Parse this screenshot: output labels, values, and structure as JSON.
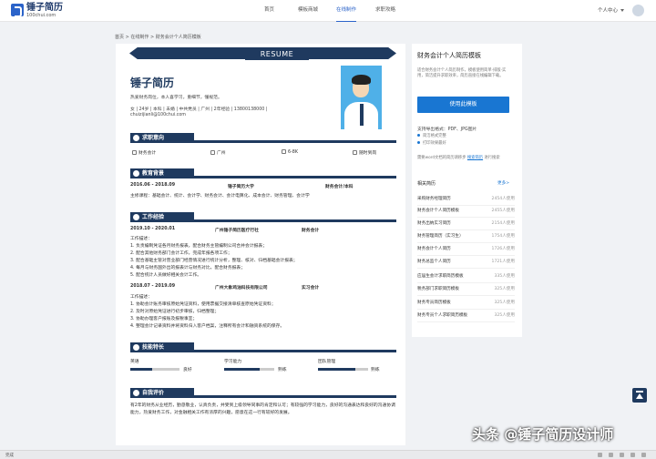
{
  "header": {
    "logo_text": "锤子简历",
    "logo_url": "100chui.com",
    "nav": [
      "首页",
      "模板商城",
      "在线制作",
      "求职攻略"
    ],
    "user_menu": "个人中心"
  },
  "breadcrumb": "首页 > 在线制作 > 财务会计个人简历模板",
  "resume": {
    "banner": "RESUME",
    "name": "锤子简历",
    "tagline": "热爱财务岗位，本人喜学习，重细节，懂规范。",
    "info": "女 | 24岁 | 本科 | 未婚 | 中共党员 | 广州 | 2年经验 | 13800138000 |",
    "email": "chuizijianli@100chui.com",
    "sections": {
      "intent": "求职意向",
      "education": "教育背景",
      "work": "工作经验",
      "skills": "技能特长",
      "evaluation": "自我评价"
    },
    "intent": {
      "position": "财务会计",
      "city": "广州",
      "salary": "6-8K",
      "availability": "随时到岗"
    },
    "education": {
      "period": "2016.06 - 2018.09",
      "school": "锤子简历大学",
      "major": "财务会计/本科",
      "courses": "主修课程：基础会计、统计、会计学、财务会计、会计电算化、成本会计、财务管理、会计学"
    },
    "work": [
      {
        "period": "2019.10 - 2020.01",
        "company": "广州锤子简历医疗行社",
        "title": "财务会计",
        "label": "工作描述：",
        "lines": [
          "1. 负责编制凭证各月财务报表，配合财务主管编制公司合并会计报表；",
          "2. 配合其他财务部门会计工作，完成年报各项工作；",
          "3. 配合基础主管对营业部门经营情况进行统计分析，整理、核对、归档基础会计报表；",
          "4. 每月与财务国外出的报表计与财务对比，配合财务报表；",
          "5. 配合统计人员做好相关会计工作。"
        ]
      },
      {
        "period": "2018.07 - 2019.09",
        "company": "广州大象鸡油科技有限公司",
        "title": "实习会计",
        "label": "工作描述：",
        "lines": [
          "1. 协助会计账务审核原始凭证资料，使用票据交接清单核查原始凭证资料；",
          "2. 及时对原始凭证进行初步审核，归档整理；",
          "3. 协助办理客户报账及报税事宜；",
          "4. 整理会计记录资料并将资料归入客户档案，注释所有会计和融资系统的保存。"
        ]
      }
    ],
    "skills": [
      {
        "name": "英语",
        "level_label": "良好",
        "level": 0.45
      },
      {
        "name": "学习能力",
        "level_label": "熟练",
        "level": 0.7
      },
      {
        "name": "团队管理",
        "level_label": "熟练",
        "level": 0.75
      }
    ],
    "evaluation": "有2年的财务从业经历，勤恳敬业，认真负责，并受到上级领导同事的肯定和认可；有较强的学习能力，良好的沟通表达和良好的沟通协调能力，热爱财务工作，对金融相关工作有浓厚的兴趣，愿意在这一行有较好的发展。"
  },
  "sidebar": {
    "title": "财务会计个人简历模板",
    "description": "适合财务会计个人简历制作，模板使用简单·排版·实用，简洁提升求职效率，简历直接在线编辑下载。",
    "use_button": "使用此模板",
    "formats_label": "支持导出格式：PDF、JPG图片",
    "features": [
      "简洁格式完整",
      "打印效果最好"
    ],
    "hint": "需要word文档的简历请移步",
    "hint_link": "搜索简历",
    "hint_after": "进行搜索",
    "related_title": "相关简历",
    "more": "更多>",
    "related": [
      {
        "name": "采购财务经理简历",
        "count": "2454人使用"
      },
      {
        "name": "财务会计个人简历模板",
        "count": "2455人使用"
      },
      {
        "name": "财务出纳实习简历",
        "count": "2154人使用"
      },
      {
        "name": "财务管理简历（实习生）",
        "count": "1754人使用"
      },
      {
        "name": "财务会计个人简历",
        "count": "1726人使用"
      },
      {
        "name": "财务总监个人简历",
        "count": "1721人使用"
      },
      {
        "name": "应届生会计求职简历模板",
        "count": "335人使用"
      },
      {
        "name": "税务部门求职简历模板",
        "count": "325人使用"
      },
      {
        "name": "财务专员简历模板",
        "count": "325人使用"
      },
      {
        "name": "财务专员个人求职简历模板",
        "count": "325人使用"
      }
    ]
  },
  "watermark": "头条 @锤子简历设计师",
  "status_text": "完成"
}
